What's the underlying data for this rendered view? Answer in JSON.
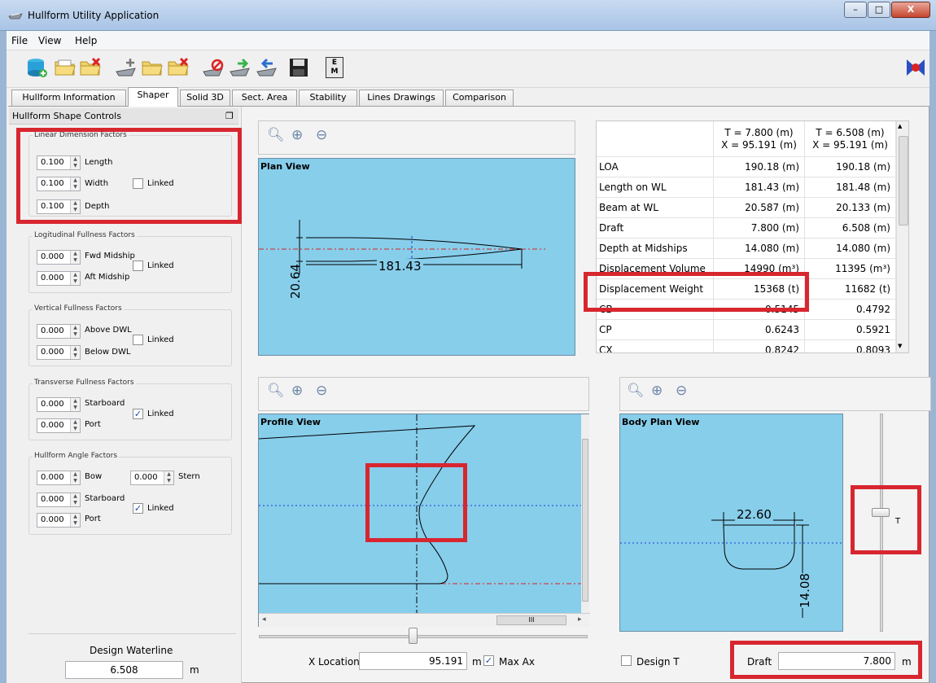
{
  "window": {
    "title": "Hullform Utility Application",
    "min": "–",
    "max": "□",
    "close": "X"
  },
  "menu": [
    "File",
    "View",
    "Help"
  ],
  "toolbar_icons": [
    "new-db-icon",
    "open-folder-icon",
    "close-folder-icon",
    "add-hull-icon",
    "open-hull-icon",
    "remove-hull-icon",
    "delete-hull-icon",
    "import-hull-icon",
    "export-hull-icon",
    "save-icon",
    "units-icon"
  ],
  "units_label": "E\nM",
  "tabs": [
    "Hullform Information",
    "Shaper",
    "Solid 3D",
    "Sect. Area",
    "Stability",
    "Lines Drawings",
    "Comparison"
  ],
  "active_tab": "Shaper",
  "left": {
    "dock_title": "Hullform Shape Controls",
    "linear": {
      "title": "Linear Dimension Factors",
      "length": "0.100",
      "length_label": "Length",
      "width": "0.100",
      "width_label": "Width",
      "depth": "0.100",
      "depth_label": "Depth",
      "linked": "Linked",
      "linked_checked": false
    },
    "longitudinal": {
      "title": "Logitudinal Fullness Factors",
      "fwd": "0.000",
      "fwd_label": "Fwd Midship",
      "aft": "0.000",
      "aft_label": "Aft Midship",
      "linked": "Linked",
      "linked_checked": false
    },
    "vertical": {
      "title": "Vertical Fullness Factors",
      "above": "0.000",
      "above_label": "Above DWL",
      "below": "0.000",
      "below_label": "Below DWL",
      "linked": "Linked",
      "linked_checked": false
    },
    "transverse": {
      "title": "Transverse Fullness Factors",
      "stbd": "0.000",
      "stbd_label": "Starboard",
      "port": "0.000",
      "port_label": "Port",
      "linked": "Linked",
      "linked_checked": true
    },
    "angle": {
      "title": "Hullform Angle Factors",
      "bow": "0.000",
      "bow_label": "Bow",
      "stern": "0.000",
      "stern_label": "Stern",
      "stbd": "0.000",
      "stbd_label": "Starboard",
      "port": "0.000",
      "port_label": "Port",
      "linked": "Linked",
      "linked_checked": true
    },
    "dwl": {
      "label": "Design Waterline",
      "value": "6.508",
      "unit": "m"
    }
  },
  "plan_view": {
    "title": "Plan View",
    "length_dim": "181.43",
    "beam_dim": "20.64"
  },
  "profile_view": {
    "title": "Profile View",
    "h_scroll_glyph": "III"
  },
  "body_plan": {
    "title": "Body Plan View",
    "beam_dim": "22.60",
    "depth_dim": "14.08",
    "slider_label": "T",
    "slider_level": 0.55
  },
  "table": {
    "headers": [
      [
        "T = 7.800 (m)",
        "X = 95.191 (m)"
      ],
      [
        "T = 6.508 (m)",
        "X = 95.191 (m)"
      ]
    ],
    "rows": [
      [
        "LOA",
        "190.18 (m)",
        "190.18 (m)"
      ],
      [
        "Length on WL",
        "181.43 (m)",
        "181.48 (m)"
      ],
      [
        "Beam at WL",
        "20.587 (m)",
        "20.133 (m)"
      ],
      [
        "Draft",
        "7.800 (m)",
        "6.508 (m)"
      ],
      [
        "Depth at Midships",
        "14.080 (m)",
        "14.080 (m)"
      ],
      [
        "Displacement Volume",
        "14990 (m³)",
        "11395 (m³)"
      ],
      [
        "Displacement Weight",
        "15368 (t)",
        "11682 (t)"
      ],
      [
        "CB",
        "0.5145",
        "0.4792"
      ],
      [
        "CP",
        "0.6243",
        "0.5921"
      ],
      [
        "CX",
        "0.8242",
        "0.8093"
      ]
    ]
  },
  "bottom": {
    "x_label": "X Location",
    "x_value": "95.191",
    "x_unit": "m",
    "max_ax": "Max Ax",
    "max_ax_checked": true,
    "design_t": "Design T",
    "design_t_checked": false,
    "draft_label": "Draft",
    "draft_value": "7.800",
    "draft_unit": "m"
  },
  "colors": {
    "view_bg": "#87ceeb",
    "highlight": "#d8262f",
    "waterline": "#1a3fd6",
    "centerline": "#d82020"
  }
}
